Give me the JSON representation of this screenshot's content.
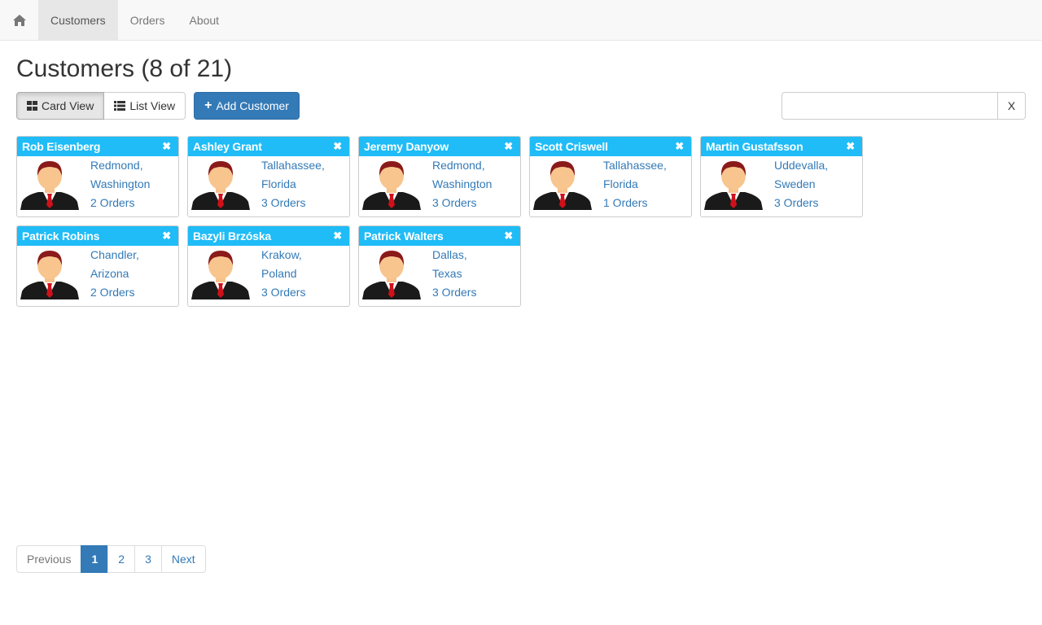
{
  "nav": {
    "home_icon": "home-icon",
    "items": [
      {
        "label": "Customers",
        "active": true
      },
      {
        "label": "Orders",
        "active": false
      },
      {
        "label": "About",
        "active": false
      }
    ]
  },
  "page": {
    "title": "Customers (8 of 21)"
  },
  "toolbar": {
    "card_view_label": "Card View",
    "list_view_label": "List View",
    "add_label": "Add Customer",
    "card_view_icon": "grid-icon",
    "list_view_icon": "list-icon"
  },
  "search": {
    "value": "",
    "placeholder": "",
    "clear_label": "X"
  },
  "customers": [
    {
      "name": "Rob Eisenberg",
      "city": "Redmond,",
      "state": "Washington",
      "orders": "2 Orders"
    },
    {
      "name": "Ashley Grant",
      "city": "Tallahassee,",
      "state": "Florida",
      "orders": "3 Orders"
    },
    {
      "name": "Jeremy Danyow",
      "city": "Redmond,",
      "state": "Washington",
      "orders": "3 Orders"
    },
    {
      "name": "Scott Criswell",
      "city": "Tallahassee,",
      "state": "Florida",
      "orders": "1 Orders"
    },
    {
      "name": "Martin Gustafsson",
      "city": "Uddevalla,",
      "state": "Sweden",
      "orders": "3 Orders"
    },
    {
      "name": "Patrick Robins",
      "city": "Chandler,",
      "state": "Arizona",
      "orders": "2 Orders"
    },
    {
      "name": "Bazyli Brzóska",
      "city": "Krakow,",
      "state": "Poland",
      "orders": "3 Orders"
    },
    {
      "name": "Patrick Walters",
      "city": "Dallas,",
      "state": "Texas",
      "orders": "3 Orders"
    }
  ],
  "pagination": {
    "previous": "Previous",
    "pages": [
      "1",
      "2",
      "3"
    ],
    "active": "1",
    "next": "Next"
  },
  "colors": {
    "card_header": "#1fbcf7",
    "primary": "#337ab7"
  }
}
